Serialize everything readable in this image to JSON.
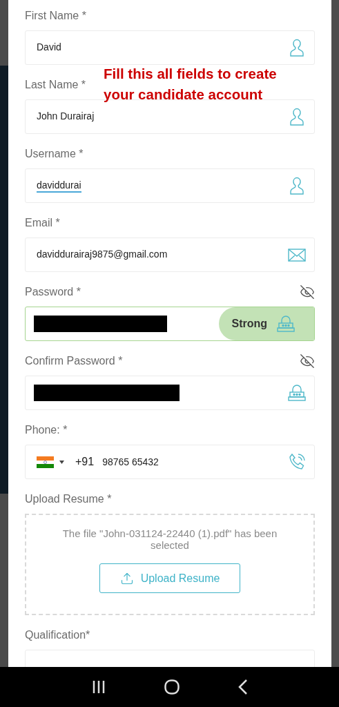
{
  "annotation": "Fill this all fields to create your candidate account",
  "fields": [
    {
      "kind": "name",
      "label": "First Name *",
      "value": "David",
      "spell_flagged": false
    },
    {
      "kind": "name",
      "label": "Last Name *",
      "value": "John Durairaj",
      "spell_flagged": false
    },
    {
      "kind": "name",
      "label": "Username *",
      "value": "daviddurai",
      "spell_flagged": true
    },
    {
      "kind": "email",
      "label": "Email *",
      "value": "daviddurairaj9875@gmail.com",
      "spell_flagged": false
    },
    {
      "kind": "password",
      "label": "Password *",
      "redacted": true,
      "strength": "Strong"
    },
    {
      "kind": "password",
      "label": "Confirm Password *",
      "redacted": true
    },
    {
      "kind": "phone",
      "label": "Phone: *",
      "dial_code": "+91",
      "value": "98765 65432"
    },
    {
      "kind": "upload",
      "label": "Upload Resume *",
      "message": "The file \"John-031124-22440 (1).pdf\" has been selected",
      "button": "Upload Resume"
    },
    {
      "kind": "select",
      "label": "Qualification*"
    }
  ]
}
